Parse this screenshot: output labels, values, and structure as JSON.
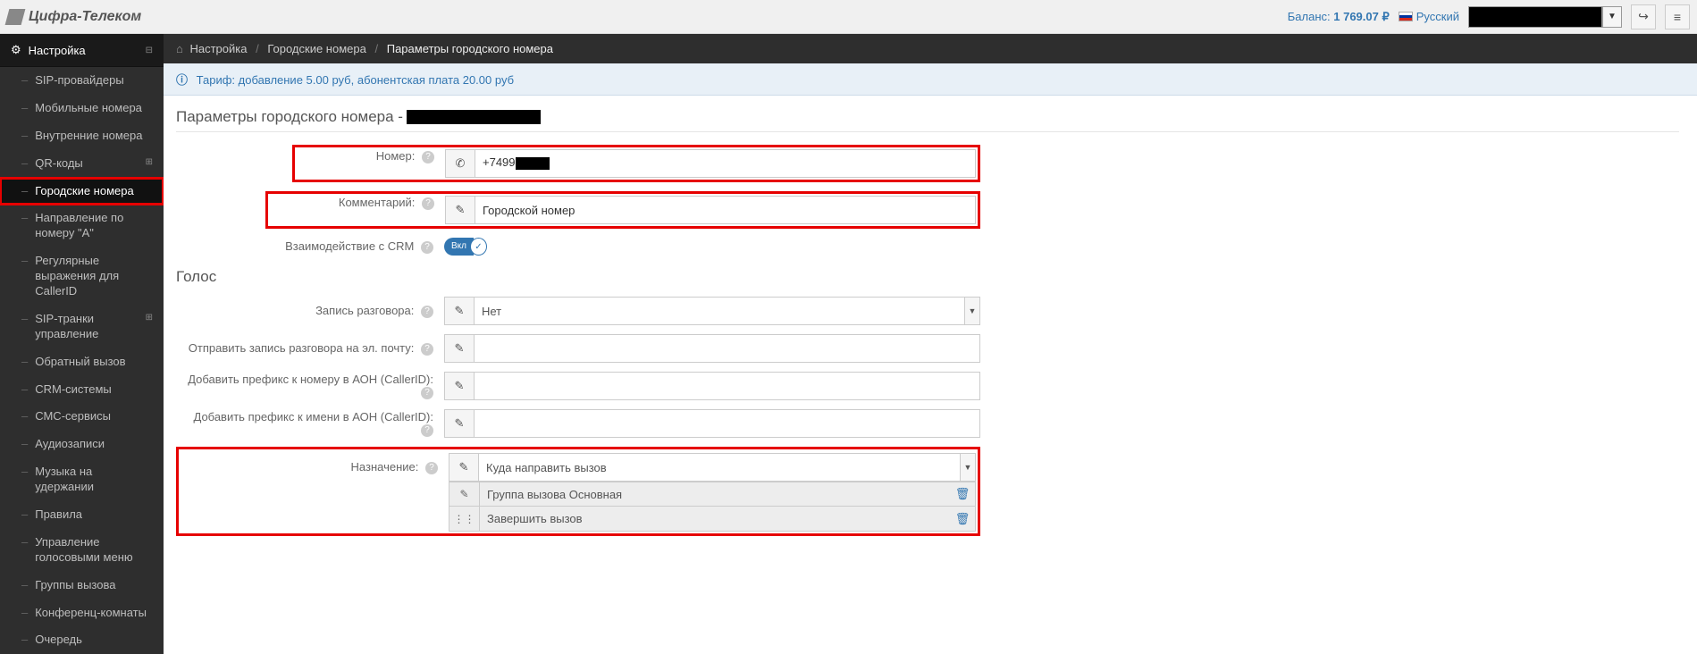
{
  "topbar": {
    "brand": "Цифра-Телеком",
    "balance_label": "Баланс:",
    "balance_amount": "1 769.07 ₽",
    "language": "Русский"
  },
  "sidebar": {
    "header": "Настройка",
    "items": [
      {
        "label": "SIP-провайдеры"
      },
      {
        "label": "Мобильные номера"
      },
      {
        "label": "Внутренние номера"
      },
      {
        "label": "QR-коды",
        "expand": true
      },
      {
        "label": "Городские номера",
        "active": true,
        "highlight": true
      },
      {
        "label": "Направление по номеру \"А\""
      },
      {
        "label": "Регулярные выражения для CallerID"
      },
      {
        "label": "SIP-транки управление",
        "expand": true
      },
      {
        "label": "Обратный вызов"
      },
      {
        "label": "CRM-системы"
      },
      {
        "label": "СМС-сервисы"
      },
      {
        "label": "Аудиозаписи"
      },
      {
        "label": "Музыка на удержании"
      },
      {
        "label": "Правила"
      },
      {
        "label": "Управление голосовыми меню"
      },
      {
        "label": "Группы вызова"
      },
      {
        "label": "Конференц-комнаты"
      },
      {
        "label": "Очередь"
      }
    ]
  },
  "breadcrumb": {
    "l1": "Настройка",
    "l2": "Городские номера",
    "l3": "Параметры городского номера"
  },
  "info": {
    "text": "Тариф: добавление 5.00 руб, абонентская плата 20.00 руб"
  },
  "section1": {
    "title_prefix": "Параметры городского номера - "
  },
  "form": {
    "number_label": "Номер:",
    "number_value_prefix": "+7499",
    "comment_label": "Комментарий:",
    "comment_value": "Городской номер",
    "crm_label": "Взаимодействие с CRM",
    "crm_on": "Вкл"
  },
  "section2": {
    "title": "Голос"
  },
  "voice": {
    "record_label": "Запись разговора:",
    "record_value": "Нет",
    "email_label": "Отправить запись разговора на эл. почту:",
    "prefix_num_label": "Добавить префикс к номеру в АОН (CallerID):",
    "prefix_name_label": "Добавить префикс к имени в АОН (CallerID):",
    "dest_label": "Назначение:",
    "dest_placeholder": "Куда направить вызов",
    "dest_items": [
      "Группа вызова Основная",
      "Завершить вызов"
    ]
  }
}
